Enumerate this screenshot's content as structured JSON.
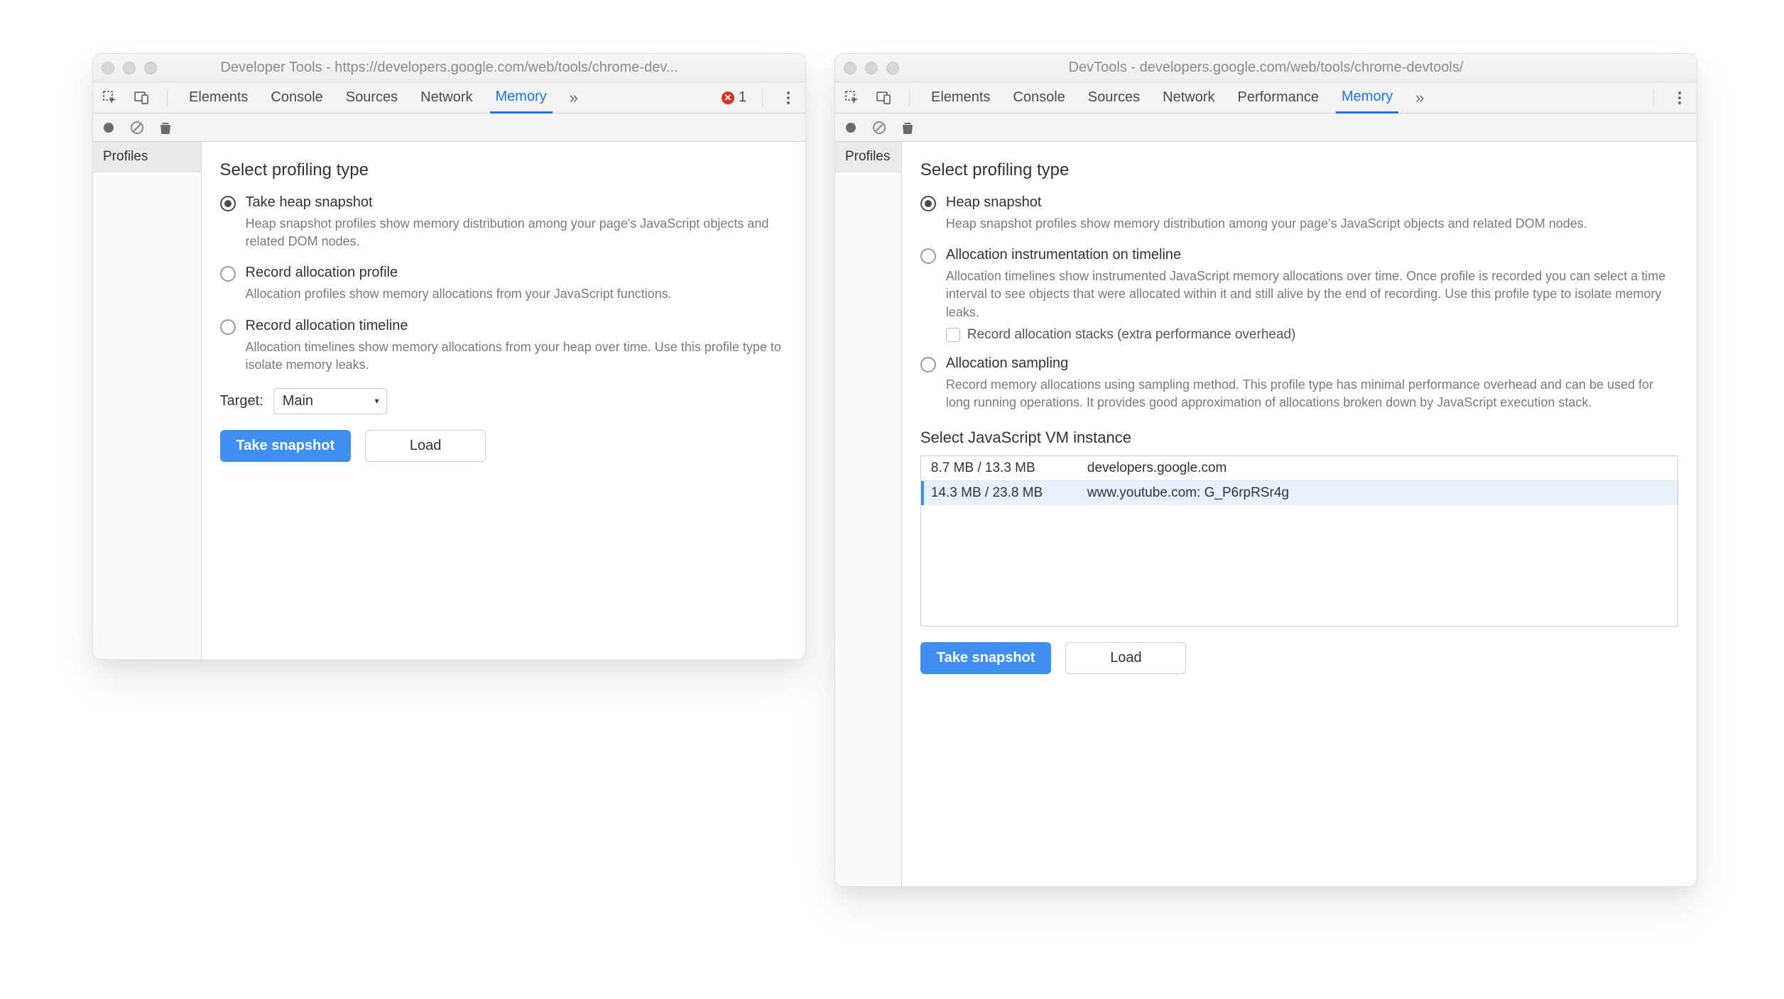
{
  "left": {
    "title": "Developer Tools - https://developers.google.com/web/tools/chrome-dev...",
    "tabs": [
      "Elements",
      "Console",
      "Sources",
      "Network",
      "Memory"
    ],
    "activeTab": "Memory",
    "errorCount": "1",
    "sidebar": {
      "profiles": "Profiles"
    },
    "heading": "Select profiling type",
    "options": {
      "snapshot": {
        "title": "Take heap snapshot",
        "desc": "Heap snapshot profiles show memory distribution among your page's JavaScript objects and related DOM nodes."
      },
      "allocProfile": {
        "title": "Record allocation profile",
        "desc": "Allocation profiles show memory allocations from your JavaScript functions."
      },
      "allocTimeline": {
        "title": "Record allocation timeline",
        "desc": "Allocation timelines show memory allocations from your heap over time. Use this profile type to isolate memory leaks."
      }
    },
    "targetLabel": "Target:",
    "targetValue": "Main",
    "buttons": {
      "primary": "Take snapshot",
      "secondary": "Load"
    }
  },
  "right": {
    "title": "DevTools - developers.google.com/web/tools/chrome-devtools/",
    "tabs": [
      "Elements",
      "Console",
      "Sources",
      "Network",
      "Performance",
      "Memory"
    ],
    "activeTab": "Memory",
    "sidebar": {
      "profiles": "Profiles"
    },
    "heading": "Select profiling type",
    "options": {
      "heap": {
        "title": "Heap snapshot",
        "desc": "Heap snapshot profiles show memory distribution among your page's JavaScript objects and related DOM nodes."
      },
      "allocTimeline": {
        "title": "Allocation instrumentation on timeline",
        "desc": "Allocation timelines show instrumented JavaScript memory allocations over time. Once profile is recorded you can select a time interval to see objects that were allocated within it and still alive by the end of recording. Use this profile type to isolate memory leaks.",
        "checkboxLabel": "Record allocation stacks (extra performance overhead)"
      },
      "sampling": {
        "title": "Allocation sampling",
        "desc": "Record memory allocations using sampling method. This profile type has minimal performance overhead and can be used for long running operations. It provides good approximation of allocations broken down by JavaScript execution stack."
      }
    },
    "vmHeading": "Select JavaScript VM instance",
    "vmRows": [
      {
        "size": "8.7 MB / 13.3 MB",
        "name": "developers.google.com"
      },
      {
        "size": "14.3 MB / 23.8 MB",
        "name": "www.youtube.com: G_P6rpRSr4g"
      }
    ],
    "buttons": {
      "primary": "Take snapshot",
      "secondary": "Load"
    }
  }
}
